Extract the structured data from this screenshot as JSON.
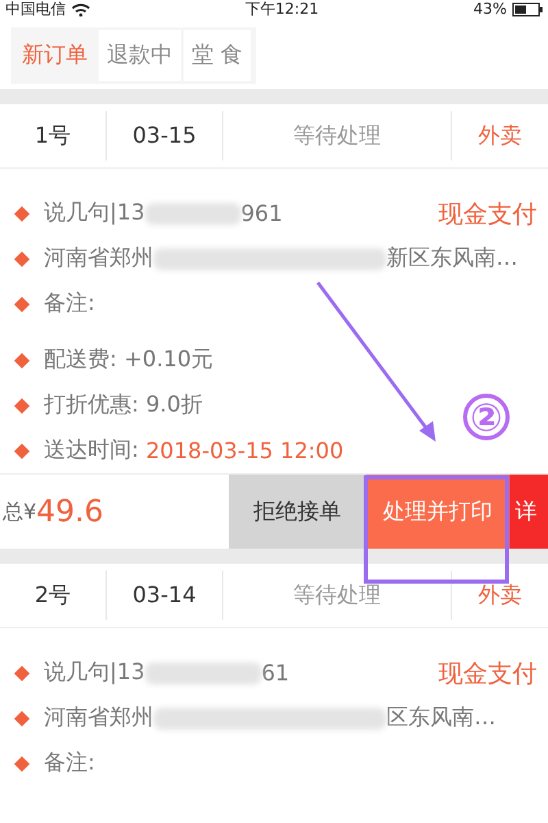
{
  "status_bar": {
    "carrier": "中国电信",
    "time": "下午12:21",
    "battery": "43%"
  },
  "tabs": [
    {
      "label": "新订单",
      "selected": true
    },
    {
      "label": "退款中",
      "selected": false
    },
    {
      "label": "堂 食",
      "selected": false
    }
  ],
  "orders": [
    {
      "number": "1号",
      "date": "03-15",
      "status": "等待处理",
      "type": "外卖",
      "name_phone_start": "说几句|13",
      "phone_end": "961",
      "payment": "现金支付",
      "address_start": "河南省郑州",
      "address_end": "新区东风南…",
      "note": "备注:",
      "details": [
        {
          "label": "配送费:",
          "value": "+0.10元"
        },
        {
          "label": "打折优惠:",
          "value": "9.0折"
        }
      ],
      "delivery_label": "送达时间:",
      "delivery_time": "2018-03-15 12:00",
      "total_label": "总¥",
      "total": "49.6",
      "actions": [
        {
          "label": "拒绝接单",
          "kind": "reject"
        },
        {
          "label": "处理并打印",
          "kind": "process"
        },
        {
          "label": "详",
          "kind": "detail"
        }
      ]
    },
    {
      "number": "2号",
      "date": "03-14",
      "status": "等待处理",
      "type": "外卖",
      "name_phone_start": "说几句|13",
      "phone_end": "61",
      "payment": "现金支付",
      "address_start": "河南省郑州",
      "address_end": "区东风南…",
      "note": "备注:"
    }
  ],
  "annotation": {
    "step": "②"
  }
}
